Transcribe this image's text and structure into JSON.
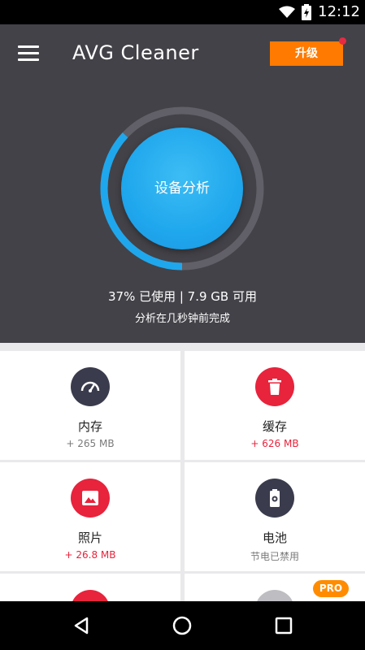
{
  "status_bar": {
    "time": "12:12"
  },
  "header": {
    "app_title": "AVG Cleaner",
    "upgrade_label": "升级",
    "analyze_label": "设备分析",
    "usage_text": "37% 已使用 | 7.9 GB 可用",
    "analysis_status": "分析在几秒钟前完成",
    "storage_used_fraction": 0.37
  },
  "cards": [
    {
      "label": "内存",
      "sub": "+ 265 MB",
      "icon": "gauge-icon"
    },
    {
      "label": "缓存",
      "sub": "+ 626 MB",
      "icon": "trash-icon"
    },
    {
      "label": "照片",
      "sub": "+ 26.8 MB",
      "icon": "image-icon"
    },
    {
      "label": "电池",
      "sub": "节电已禁用",
      "icon": "battery-gear-icon"
    }
  ],
  "pro_badge": "PRO",
  "colors": {
    "accent": "#1fa7ed",
    "upgrade": "#ff7a00",
    "red": "#e8233c",
    "dark": "#3a3c4d",
    "header_bg": "#434248"
  }
}
